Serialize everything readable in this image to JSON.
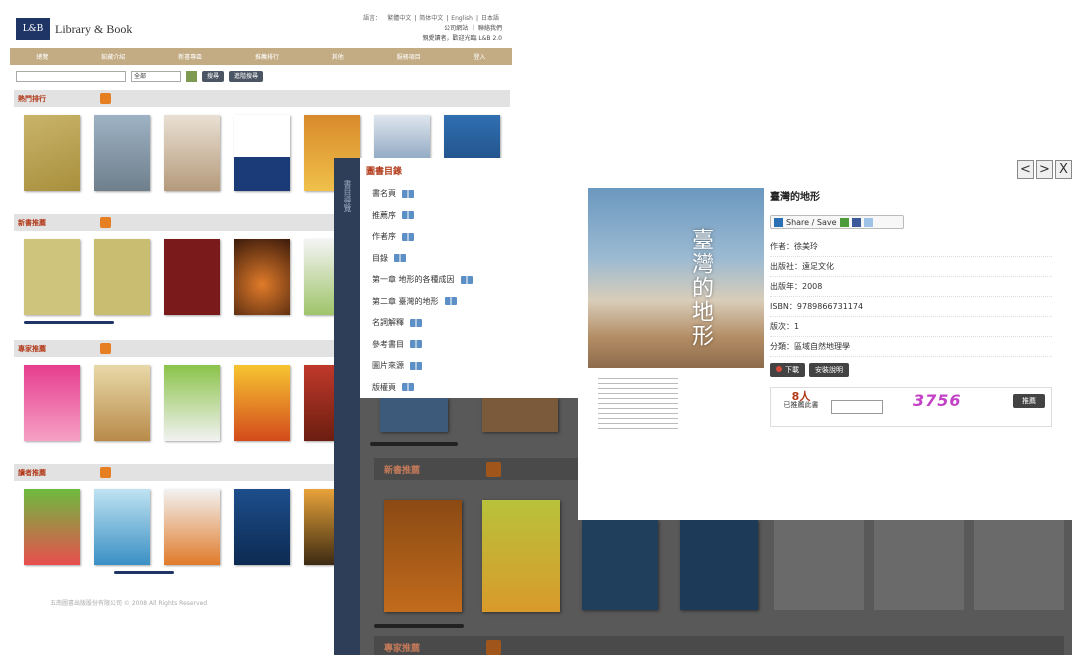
{
  "site": {
    "logo_mark": "L&B",
    "logo_text": "Library & Book",
    "lang_prefix": "語言：",
    "languages": [
      "繁體中文",
      "简体中文",
      "English",
      "日本語"
    ],
    "links": "公司網站 ｜ 聯絡我們",
    "welcome": "親愛讀者，歡迎光臨 L&B 2.0"
  },
  "nav": [
    "總覽",
    "館藏介紹",
    "新書專區",
    "推薦排行",
    "其他",
    "服務項目",
    "登入"
  ],
  "search": {
    "select_value": "全部",
    "search_button": "搜尋",
    "advanced_button": "進階搜尋"
  },
  "sections": [
    {
      "title": "熱門排行"
    },
    {
      "title": "新書推薦"
    },
    {
      "title": "專家推薦"
    },
    {
      "title": "讀者推薦"
    }
  ],
  "footer": "五南圖書出版股份有限公司 © 2008 All Rights Reserved",
  "dark_sections": [
    {
      "title": "新書推薦"
    },
    {
      "title": "專家推薦"
    }
  ],
  "toc": {
    "side_tab": "書目導覽",
    "title": "圖書目錄",
    "items": [
      "書名頁",
      "推薦序",
      "作者序",
      "目錄",
      "第一章 地形的各種成因",
      "第二章 臺灣的地形",
      "名詞解釋",
      "參考書目",
      "圖片來源",
      "版權頁"
    ]
  },
  "detail": {
    "cover_title": "臺灣的地形",
    "title": "臺灣的地形",
    "share_label": "Share / Save",
    "author": "作者：徐美玲",
    "publisher": "出版社：遠足文化",
    "year": "出版年：2008",
    "isbn": "ISBN：9789866731174",
    "edition": "版次：1",
    "category": "分類：區域自然地理學",
    "download_button": "下載",
    "install_button": "安裝說明",
    "vote_count": "8人",
    "vote_text": "已推薦此書",
    "captcha": "3756",
    "vote_button": "推薦"
  },
  "nav_buttons": {
    "prev": "<",
    "next": ">",
    "close": "X"
  }
}
